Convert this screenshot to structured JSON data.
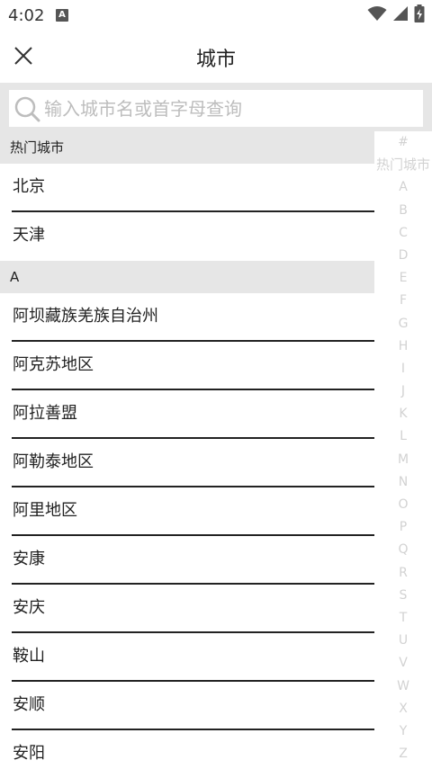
{
  "status": {
    "time": "4:02",
    "notification_glyph": "A"
  },
  "header": {
    "title": "城市"
  },
  "search": {
    "placeholder": "输入城市名或首字母查询"
  },
  "sections": {
    "hot": {
      "header": "热门城市",
      "cities": [
        "北京",
        "天津"
      ]
    },
    "a": {
      "header": "A",
      "cities": [
        "阿坝藏族羌族自治州",
        "阿克苏地区",
        "阿拉善盟",
        "阿勒泰地区",
        "阿里地区",
        "安康",
        "安庆",
        "鞍山",
        "安顺",
        "安阳"
      ]
    }
  },
  "index": [
    "#",
    "热门城市",
    "A",
    "B",
    "C",
    "D",
    "E",
    "F",
    "G",
    "H",
    "I",
    "J",
    "K",
    "L",
    "M",
    "N",
    "O",
    "P",
    "Q",
    "R",
    "S",
    "T",
    "U",
    "V",
    "W",
    "X",
    "Y",
    "Z"
  ],
  "colors": {
    "section_bg": "#e6e6e6",
    "index_text": "#d2d2d2",
    "divider": "#222222"
  }
}
